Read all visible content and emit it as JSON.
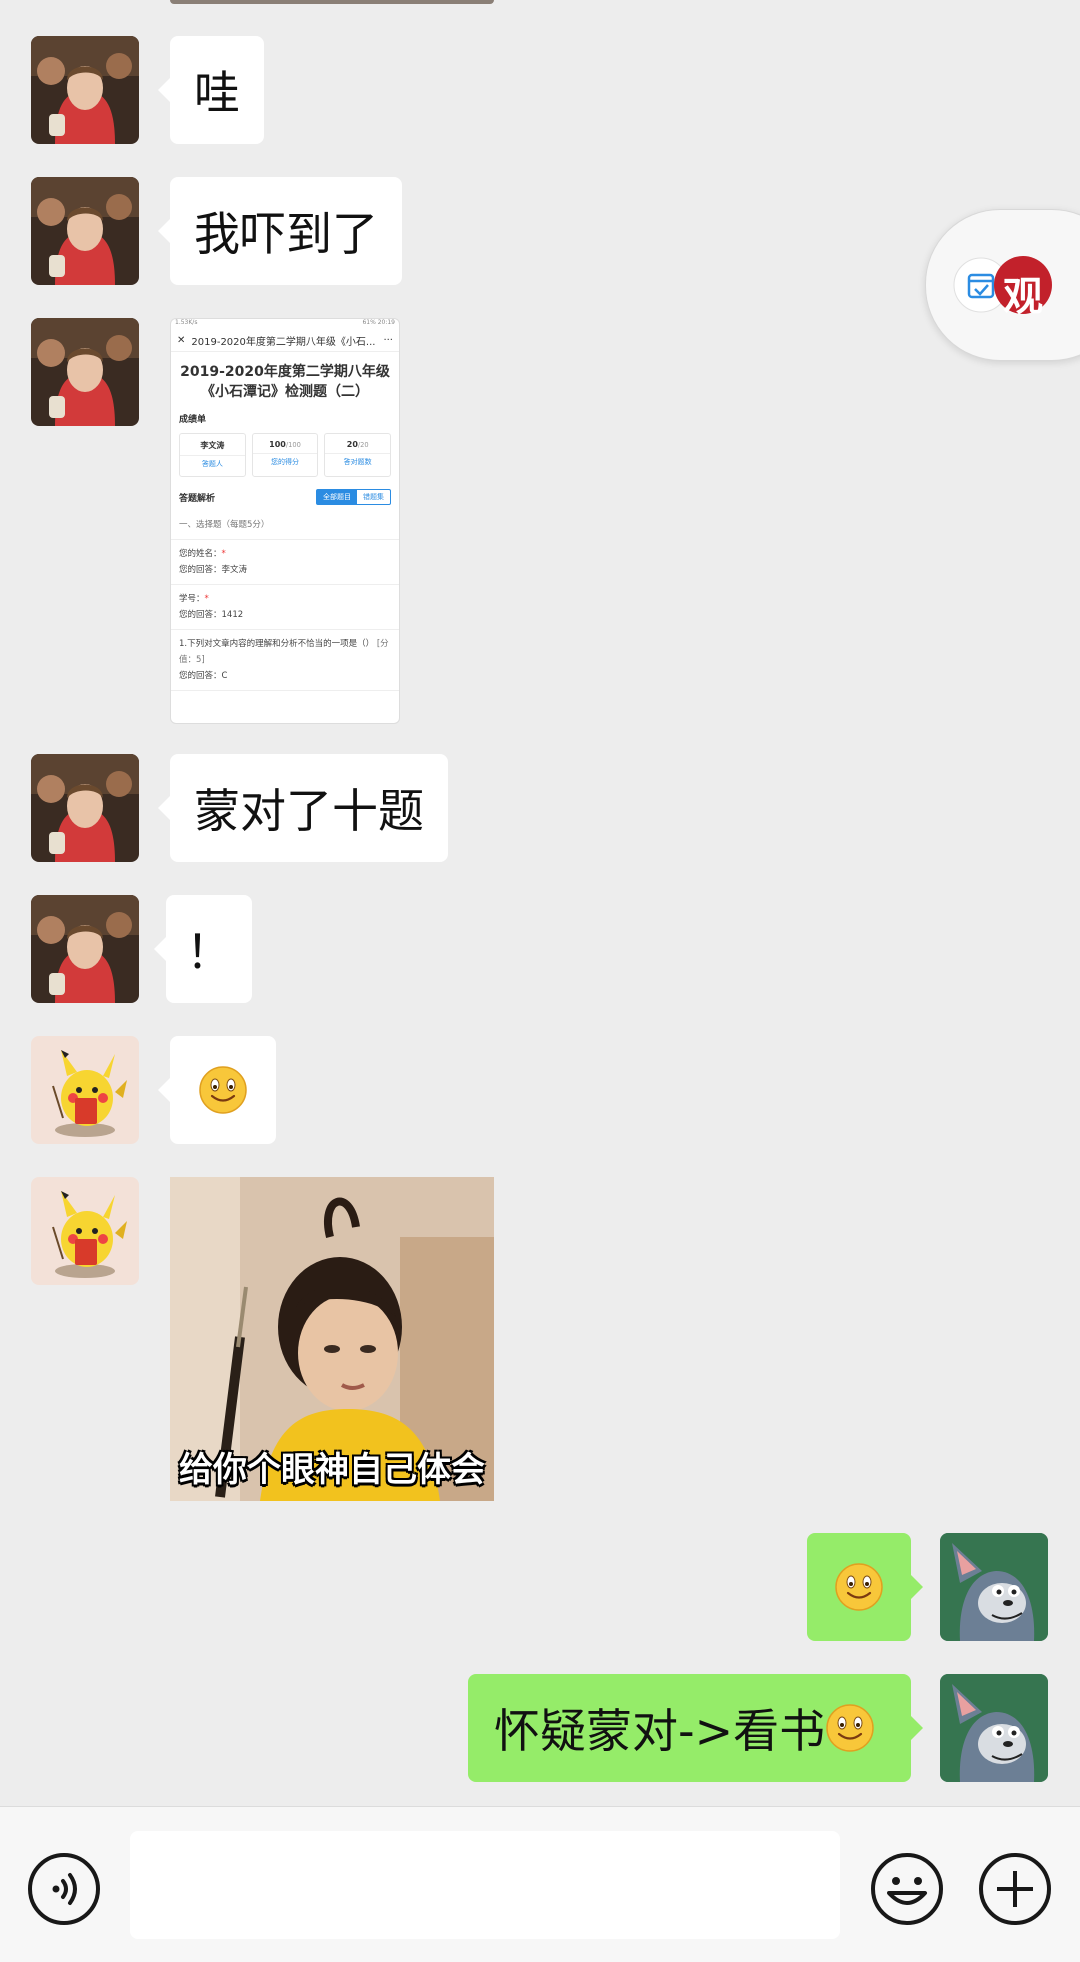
{
  "chat": {
    "messages": [
      {
        "side": "left",
        "sender": "friend-1",
        "type": "text",
        "text": "哇"
      },
      {
        "side": "left",
        "sender": "friend-1",
        "type": "text",
        "text": "我吓到了"
      },
      {
        "side": "left",
        "sender": "friend-1",
        "type": "image-screenshot"
      },
      {
        "side": "left",
        "sender": "friend-1",
        "type": "text",
        "text": "蒙对了十题"
      },
      {
        "side": "left",
        "sender": "friend-1",
        "type": "text",
        "text": "！"
      },
      {
        "side": "left",
        "sender": "friend-2",
        "type": "emoji",
        "icon": "smile-emoji"
      },
      {
        "side": "left",
        "sender": "friend-2",
        "type": "sticker",
        "caption": "给你个眼神自己体会"
      },
      {
        "side": "right",
        "sender": "me",
        "type": "emoji",
        "icon": "smile-emoji"
      },
      {
        "side": "right",
        "sender": "me",
        "type": "text",
        "text": "怀疑蒙对->看书",
        "icon": "smile-emoji"
      }
    ]
  },
  "screenshot": {
    "status_left": "1.53K/s",
    "status_right": "61% 20:19",
    "nav_title": "2019-2020年度第二学期八年级《小石...",
    "title": "2019-2020年度第二学期八年级《小石潭记》检测题（二）",
    "scorecard_label": "成绩单",
    "cards": [
      {
        "value": "李文涛",
        "total": "",
        "sub": "答题人"
      },
      {
        "value": "100",
        "total": "/100",
        "sub": "您的得分"
      },
      {
        "value": "20",
        "total": "/20",
        "sub": "答对题数"
      }
    ],
    "analysis_label": "答题解析",
    "seg_all": "全部题目",
    "seg_wrong": "错题集",
    "section": "一、选择题（每题5分）",
    "name_q": "您的姓名：",
    "name_a": "您的回答：李文涛",
    "id_q": "学号：",
    "id_a": "您的回答：1412",
    "q1": "1.下列对文章内容的理解和分析不恰当的一项是（）",
    "q1_score": "[分值：5]",
    "q1_answer": "您的回答：C"
  },
  "colors": {
    "me_bubble": "#95ec69",
    "background": "#ededed",
    "bubble": "#ffffff"
  },
  "floating_widget": {
    "badge_text": "观",
    "icons": [
      "calendar-check-icon",
      "guan-badge-icon"
    ]
  },
  "input_bar": {
    "icons": [
      "voice-icon",
      "emoji-icon",
      "plus-icon"
    ]
  }
}
